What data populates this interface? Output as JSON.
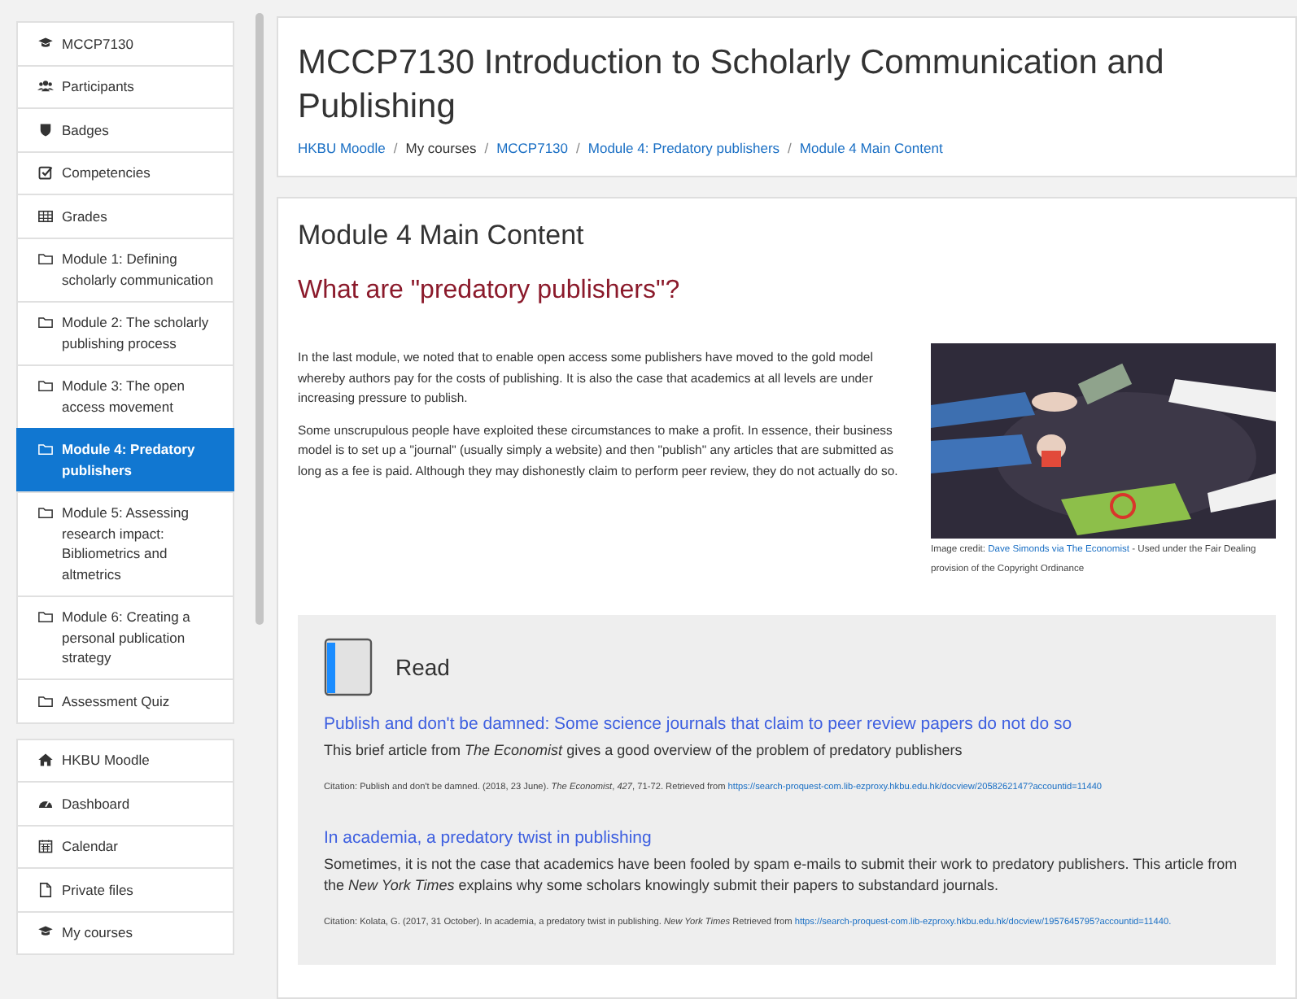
{
  "sidebar": {
    "groups": [
      {
        "items": [
          {
            "label": "MCCP7130",
            "kind": "cap",
            "selected": false
          },
          {
            "label": "Participants",
            "kind": "users",
            "selected": false
          },
          {
            "label": "Badges",
            "kind": "shield",
            "selected": false
          },
          {
            "label": "Competencies",
            "kind": "check",
            "selected": false
          },
          {
            "label": "Grades",
            "kind": "table",
            "selected": false
          },
          {
            "label": "Module 1: Defining scholarly communication",
            "kind": "folder",
            "selected": false
          },
          {
            "label": "Module 2: The scholarly publishing process",
            "kind": "folder",
            "selected": false
          },
          {
            "label": "Module 3: The open access movement",
            "kind": "folder",
            "selected": false
          },
          {
            "label": "Module 4: Predatory publishers",
            "kind": "folder",
            "selected": true
          },
          {
            "label": "Module 5: Assessing research impact: Bibliometrics and altmetrics",
            "kind": "folder",
            "selected": false
          },
          {
            "label": "Module 6: Creating a personal publication strategy",
            "kind": "folder",
            "selected": false
          },
          {
            "label": "Assessment Quiz",
            "kind": "folder",
            "selected": false
          }
        ]
      },
      {
        "items": [
          {
            "label": "HKBU Moodle",
            "kind": "home",
            "selected": false
          },
          {
            "label": "Dashboard",
            "kind": "gauge",
            "selected": false
          },
          {
            "label": "Calendar",
            "kind": "calendar",
            "selected": false
          },
          {
            "label": "Private files",
            "kind": "file",
            "selected": false
          },
          {
            "label": "My courses",
            "kind": "cap",
            "selected": false
          }
        ]
      }
    ]
  },
  "header": {
    "title": "MCCP7130 Introduction to Scholarly Communication and Publishing",
    "breadcrumb": {
      "separator": "/",
      "items": [
        {
          "label": "HKBU Moodle",
          "kind": "link"
        },
        {
          "label": "My courses",
          "kind": "text"
        },
        {
          "label": "MCCP7130",
          "kind": "link"
        },
        {
          "label": "Module 4: Predatory publishers",
          "kind": "link"
        },
        {
          "label": "Module 4 Main Content",
          "kind": "link"
        }
      ]
    }
  },
  "content": {
    "title": "Module 4 Main Content",
    "heading": "What are \"predatory publishers\"?",
    "paragraphs": [
      "In the last module, we noted that to enable open access some publishers have moved to the gold  model whereby authors pay for the costs of publishing. It is also the case that academics at all levels are under increasing pressure to publish.",
      "Some unscrupulous people have exploited these circumstances to make a profit. In essence, their business model is to set up a \"journal\" (usually simply a website) and then \"publish\" any articles that are submitted as long as a fee is paid. Although they may dishonestly claim to perform peer review, they do not actually do so."
    ],
    "image_credit": {
      "before": "Image credit: ",
      "link": "Dave Simonds via The Economist",
      "after": " - Used under the Fair Dealing provision of the Copyright Ordinance"
    },
    "read": {
      "title": "Read",
      "items": [
        {
          "title": "Publish and don't be damned: Some science journals that claim to peer review papers do not do so",
          "description": "This brief article from *The Economist* gives a good overview of the problem of predatory publishers",
          "citation": "Citation: Publish and don't be damned. (2018, 23 June). *The Economist*, *427*, 71-72. Retrieved from ",
          "link": "https://search-proquest-com.lib-ezproxy.hkbu.edu.hk/docview/2058262147?accountid=11440"
        },
        {
          "title": "In academia, a predatory twist in publishing",
          "description": "Sometimes, it is not the case that academics have been fooled by spam e-mails to submit their work to predatory publishers. This article from the *New York Times* explains why some scholars knowingly submit their papers to substandard journals.",
          "citation": "Citation: Kolata, G. (2017, 31 October). In academia, a predatory twist in publishing. *New York Times* Retrieved from ",
          "link": "https://search-proquest-com.lib-ezproxy.hkbu.edu.hk/docview/1957645795?accountid=11440."
        }
      ]
    }
  }
}
